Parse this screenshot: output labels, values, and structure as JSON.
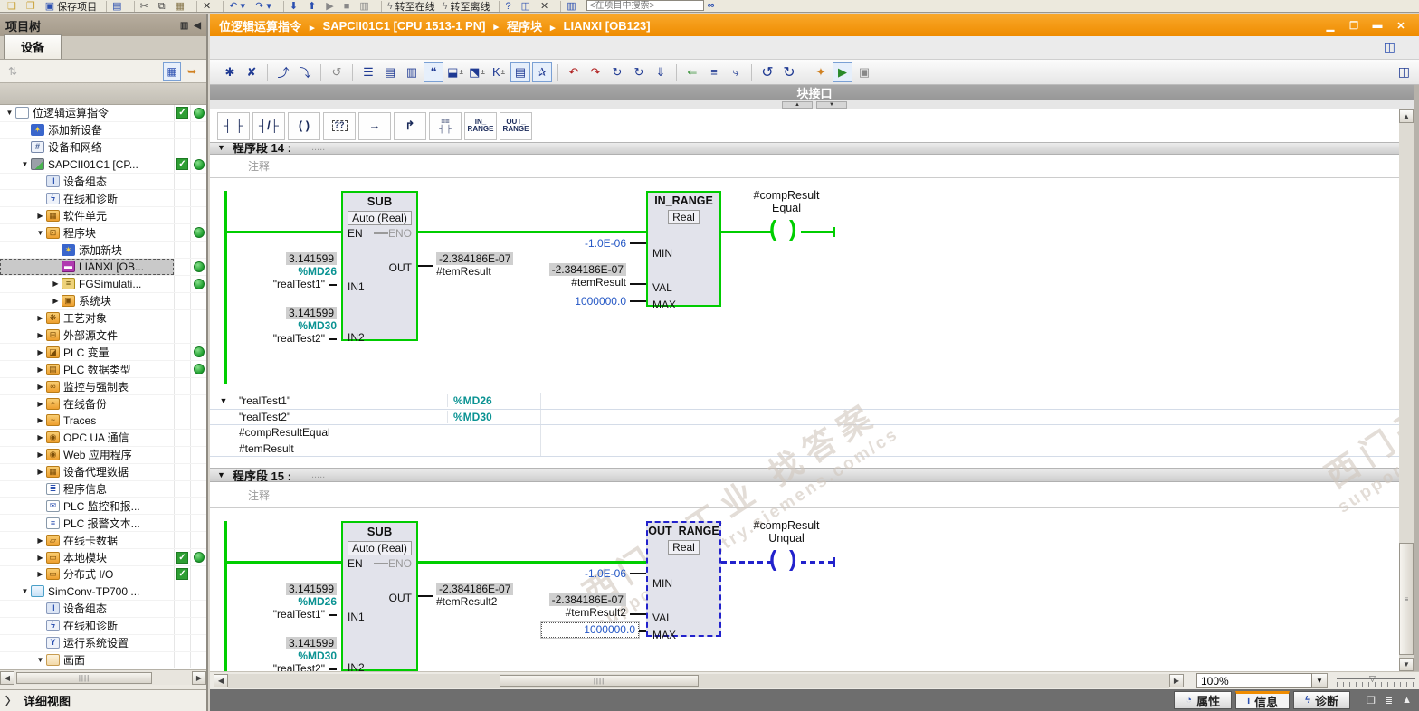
{
  "top_toolbar": {
    "search_placeholder": "<在项目中搜索>",
    "items": [
      {
        "n": "new-project",
        "g": "❏",
        "c": "#caa23a"
      },
      {
        "n": "open-project",
        "g": "❐",
        "c": "#caa23a"
      },
      {
        "n": "save-project-button",
        "g": "▣",
        "c": "#2b4fb0",
        "label": "保存项目"
      },
      {
        "n": "print-button",
        "g": "▤",
        "c": "#2b4fb0",
        "sep": 1
      },
      {
        "n": "cut-button",
        "g": "✂",
        "c": "#444",
        "sep": 1
      },
      {
        "n": "copy-button",
        "g": "⧉",
        "c": "#444"
      },
      {
        "n": "paste-button",
        "g": "▦",
        "c": "#8a7a50"
      },
      {
        "n": "delete-button",
        "g": "✕",
        "c": "#333",
        "sep": 1
      },
      {
        "n": "undo-button",
        "g": "↶ ▾",
        "c": "#2b4fb0",
        "sep": 1
      },
      {
        "n": "redo-button",
        "g": "↷ ▾",
        "c": "#2b4fb0"
      },
      {
        "n": "download-to-device-button",
        "g": "⬇",
        "c": "#2b4fb0",
        "sep": 1
      },
      {
        "n": "upload-from-device-button",
        "g": "⬆",
        "c": "#2b4fb0"
      },
      {
        "n": "start-cpu-button",
        "g": "▶",
        "c": "#888"
      },
      {
        "n": "stop-cpu-button",
        "g": "■",
        "c": "#888"
      },
      {
        "n": "start-runtime-button",
        "g": "▥",
        "c": "#888"
      },
      {
        "n": "go-online-button",
        "g": "ϟ",
        "c": "#777",
        "label": "转至在线",
        "sep": 1
      },
      {
        "n": "go-offline-button",
        "g": "ϟ",
        "c": "#777",
        "label": "转至离线"
      },
      {
        "n": "online-diagnostics-button",
        "g": "?",
        "c": "#2b4fb0",
        "sep": 1
      },
      {
        "n": "window-button",
        "g": "◫",
        "c": "#2b4fb0"
      },
      {
        "n": "cross-reference-button",
        "g": "✕",
        "c": "#444"
      },
      {
        "n": "split-editor-button",
        "g": "▥",
        "c": "#2b4fb0",
        "sep": 1
      }
    ],
    "find_icon": "∞"
  },
  "header": {
    "breadcrumb": [
      "位逻辑运算指令",
      "SAPCII01C1 [CPU 1513-1 PN]",
      "程序块",
      "LIANXI [OB123]"
    ],
    "window_buttons": [
      {
        "n": "minimize-button",
        "g": "▁"
      },
      {
        "n": "restore-button",
        "g": "❐"
      },
      {
        "n": "maximize-button",
        "g": "▬"
      },
      {
        "n": "close-button",
        "g": "✕"
      }
    ]
  },
  "project_tree": {
    "title": "项目树",
    "header_icons": [
      {
        "n": "pin-panel-button",
        "g": "▥"
      },
      {
        "n": "collapse-panel-button",
        "g": "◀"
      }
    ],
    "tab": "设备",
    "toolbar": [
      {
        "n": "sort-button",
        "g": "⇅",
        "gray": 1
      },
      {
        "n": "table-view-button",
        "g": "▦",
        "push": 1,
        "right": 1
      },
      {
        "n": "export-button",
        "g": "➥",
        "right": 1
      }
    ],
    "detail_view": "详细视图",
    "detail_chevron": "〉",
    "items": [
      {
        "l": "位逻辑运算指令",
        "lv": 0,
        "ex": "▼",
        "ic": "project",
        "chk": 1,
        "dot": 1
      },
      {
        "l": "添加新设备",
        "lv": 1,
        "ex": "",
        "ic": "add-device",
        "g": "✶"
      },
      {
        "l": "设备和网络",
        "lv": 1,
        "ex": "",
        "ic": "network",
        "g": "#"
      },
      {
        "l": "SAPCII01C1 [CP...",
        "lv": 1,
        "ex": "▼",
        "ic": "plc",
        "chk": 1,
        "dot": 1
      },
      {
        "l": "设备组态",
        "lv": 2,
        "ex": "",
        "ic": "devconf",
        "g": "‖"
      },
      {
        "l": "在线和诊断",
        "lv": 2,
        "ex": "",
        "ic": "diag",
        "g": "ϟ"
      },
      {
        "l": "软件单元",
        "lv": 2,
        "ex": "▶",
        "ic": "folder-units",
        "g": "▦"
      },
      {
        "l": "程序块",
        "lv": 2,
        "ex": "▼",
        "ic": "folder-blocks",
        "g": "⊡",
        "dot": 1
      },
      {
        "l": "添加新块",
        "lv": 3,
        "ex": "",
        "ic": "add-block",
        "g": "✶"
      },
      {
        "l": "LIANXI [OB...",
        "lv": 3,
        "ex": "",
        "ic": "ob",
        "g": "▬",
        "dot": 1,
        "sel": 1
      },
      {
        "l": "FGSimulati...",
        "lv": 3,
        "ex": "▶",
        "ic": "fb",
        "g": "≡",
        "dot": 1
      },
      {
        "l": "系统块",
        "lv": 3,
        "ex": "▶",
        "ic": "folder-sys",
        "g": "▣"
      },
      {
        "l": "工艺对象",
        "lv": 2,
        "ex": "▶",
        "ic": "folder-tech",
        "g": "❋"
      },
      {
        "l": "外部源文件",
        "lv": 2,
        "ex": "▶",
        "ic": "folder-src",
        "g": "⊟"
      },
      {
        "l": "PLC 变量",
        "lv": 2,
        "ex": "▶",
        "ic": "folder-tags",
        "g": "◪",
        "dot": 1
      },
      {
        "l": "PLC 数据类型",
        "lv": 2,
        "ex": "▶",
        "ic": "folder-types",
        "g": "▤",
        "dot": 1
      },
      {
        "l": "监控与强制表",
        "lv": 2,
        "ex": "▶",
        "ic": "folder-watch",
        "g": "∞"
      },
      {
        "l": "在线备份",
        "lv": 2,
        "ex": "▶",
        "ic": "folder-backup",
        "g": "◓"
      },
      {
        "l": "Traces",
        "lv": 2,
        "ex": "▶",
        "ic": "folder-traces",
        "g": "~"
      },
      {
        "l": "OPC UA 通信",
        "lv": 2,
        "ex": "▶",
        "ic": "folder-opc",
        "g": "◉"
      },
      {
        "l": "Web 应用程序",
        "lv": 2,
        "ex": "▶",
        "ic": "folder-web",
        "g": "◉"
      },
      {
        "l": "设备代理数据",
        "lv": 2,
        "ex": "▶",
        "ic": "folder-proxy",
        "g": "▦"
      },
      {
        "l": "程序信息",
        "lv": 2,
        "ex": "",
        "ic": "proginfo",
        "g": "≣"
      },
      {
        "l": "PLC 监控和报...",
        "lv": 2,
        "ex": "",
        "ic": "alarm",
        "g": "✉"
      },
      {
        "l": "PLC 报警文本...",
        "lv": 2,
        "ex": "",
        "ic": "alarmtext",
        "g": "≡"
      },
      {
        "l": "在线卡数据",
        "lv": 2,
        "ex": "▶",
        "ic": "folder-card",
        "g": "▱"
      },
      {
        "l": "本地模块",
        "lv": 2,
        "ex": "▶",
        "ic": "folder-local",
        "g": "▭",
        "chk": 1,
        "dot": 1
      },
      {
        "l": "分布式 I/O",
        "lv": 2,
        "ex": "▶",
        "ic": "folder-dio",
        "g": "▭",
        "chk": 1
      },
      {
        "l": "SimConv-TP700 ...",
        "lv": 1,
        "ex": "▼",
        "ic": "folder-hmi",
        "g": ""
      },
      {
        "l": "设备组态",
        "lv": 2,
        "ex": "",
        "ic": "devconf",
        "g": "‖"
      },
      {
        "l": "在线和诊断",
        "lv": 2,
        "ex": "",
        "ic": "diag",
        "g": "ϟ"
      },
      {
        "l": "运行系统设置",
        "lv": 2,
        "ex": "",
        "ic": "runtime",
        "g": "Y"
      },
      {
        "l": "画面",
        "lv": 2,
        "ex": "▼",
        "ic": "folder-screens",
        "g": ""
      }
    ]
  },
  "editor": {
    "block_interface_label": "块接口",
    "subbar_icon": "◫",
    "toolbar": [
      {
        "n": "insert-network-button",
        "g": "✱"
      },
      {
        "n": "delete-network-button",
        "g": "✘"
      },
      {
        "n": "open-branch-button",
        "g": "⤴",
        "sep": 1
      },
      {
        "n": "close-branch-button",
        "g": "⤵"
      },
      {
        "n": "reset-layout-button",
        "g": "↺",
        "c": "#888",
        "sep": 1
      },
      {
        "n": "expand-all-networks-button",
        "g": "☰",
        "sep": 1
      },
      {
        "n": "collapse-all-networks-button",
        "g": "▤"
      },
      {
        "n": "toggle-network-view-button",
        "g": "▥"
      },
      {
        "n": "network-comments-toggle",
        "g": "❝",
        "pressed": 1
      },
      {
        "n": "insert-block-dropdown",
        "g": "⬓",
        "dd": 1
      },
      {
        "n": "insert-placeholder-dropdown",
        "g": "⬔",
        "dd": 1
      },
      {
        "n": "rename-operand-dropdown",
        "g": "K",
        "dd": 1
      },
      {
        "n": "absolute-symbolic-toggle",
        "g": "▤",
        "pressed": 1
      },
      {
        "n": "favorites-toggle",
        "g": "✰",
        "pressed": 1
      },
      {
        "n": "previous-error-button",
        "g": "↶",
        "c": "#b02020",
        "sep": 1
      },
      {
        "n": "next-error-button",
        "g": "↷",
        "c": "#b02020"
      },
      {
        "n": "update-block-calls-button",
        "g": "↻"
      },
      {
        "n": "refresh-interface-button",
        "g": "↻"
      },
      {
        "n": "consistency-check-button",
        "g": "⇓"
      },
      {
        "n": "jump-to-start-button",
        "g": "⇐",
        "c": "#2a8a2a",
        "sep": 1
      },
      {
        "n": "insert-line-button",
        "g": "≡"
      },
      {
        "n": "branch-out-button",
        "g": "⤷"
      },
      {
        "n": "undo-button",
        "g": "↺",
        "big": 1,
        "sep": 1
      },
      {
        "n": "redo-button",
        "g": "↻",
        "big": 1
      },
      {
        "n": "go-to-usage-button",
        "g": "✦",
        "c": "#d08020",
        "sep": 1
      },
      {
        "n": "monitoring-toggle",
        "g": "▶",
        "c": "#2a8a2a",
        "pressed": 1
      },
      {
        "n": "snapshot-button",
        "g": "▣",
        "c": "#888"
      }
    ],
    "interface_arrows": [
      "▲",
      "▼"
    ],
    "favorites": [
      {
        "n": "contact-open-button",
        "l1": "┤ ├",
        "l2": ""
      },
      {
        "n": "contact-closed-button",
        "l1": "┤/├",
        "l2": ""
      },
      {
        "n": "coil-button",
        "l1": "( )",
        "l2": ""
      },
      {
        "n": "empty-box-button",
        "l1": "??",
        "l2": "",
        "boxed": 1
      },
      {
        "n": "open-branch-button",
        "l1": "→",
        "l2": ""
      },
      {
        "n": "close-branch-button",
        "l1": "↱",
        "l2": ""
      },
      {
        "n": "compare-contact-button",
        "l1": "==",
        "l2": "┤ ├",
        "small": 1
      },
      {
        "n": "in-range-button",
        "l1": "IN_",
        "l2": "RANGE",
        "small": 1
      },
      {
        "n": "out-range-button",
        "l1": "OUT_",
        "l2": "RANGE",
        "small": 1
      }
    ],
    "networks": [
      {
        "title": "程序段 14 :",
        "dots": ".....",
        "collapse": "▼",
        "comment": "注释",
        "sub": {
          "title": "SUB",
          "mode": "Auto (Real)",
          "en": "EN",
          "eno": "ENO",
          "pin_in1": "IN1",
          "pin_in2": "IN2",
          "pin_out": "OUT",
          "in1": {
            "value": "3.141599",
            "addr": "%MD26",
            "tag": "\"realTest1\""
          },
          "in2": {
            "value": "3.141599",
            "addr": "%MD30",
            "tag": "\"realTest2\""
          },
          "out": {
            "value": "-2.384186E-07",
            "tag": "#temResult"
          }
        },
        "range": {
          "title": "IN_RANGE",
          "dtype": "Real",
          "pin_min": "MIN",
          "pin_val": "VAL",
          "pin_max": "MAX",
          "min": "-1.0E-06",
          "val": {
            "value": "-2.384186E-07",
            "tag": "#temResult"
          },
          "max": "1000000.0"
        },
        "coil": {
          "line1": "#compResult",
          "line2": "Equal"
        }
      },
      {
        "title": "程序段 15 :",
        "dots": ".....",
        "collapse": "▼",
        "comment": "注释",
        "sub": {
          "title": "SUB",
          "mode": "Auto (Real)",
          "en": "EN",
          "eno": "ENO",
          "pin_in1": "IN1",
          "pin_in2": "IN2",
          "pin_out": "OUT",
          "in1": {
            "value": "3.141599",
            "addr": "%MD26",
            "tag": "\"realTest1\""
          },
          "in2": {
            "value": "3.141599",
            "addr": "%MD30",
            "tag": "\"realTest2\""
          },
          "out": {
            "value": "-2.384186E-07",
            "tag": "#temResult2"
          }
        },
        "range": {
          "title": "OUT_RANGE",
          "dtype": "Real",
          "pin_min": "MIN",
          "pin_val": "VAL",
          "pin_max": "MAX",
          "min": "-1.0E-06",
          "val": {
            "value": "-2.384186E-07",
            "tag": "#temResult2"
          },
          "max": "1000000.0"
        },
        "coil": {
          "line1": "#compResult",
          "line2": "Unqual"
        }
      }
    ],
    "var_table": [
      {
        "exp": "▼",
        "name": "\"realTest1\"",
        "addr": "%MD26"
      },
      {
        "exp": "",
        "name": "\"realTest2\"",
        "addr": "%MD30"
      },
      {
        "exp": "",
        "name": "#compResultEqual",
        "addr": ""
      },
      {
        "exp": "",
        "name": "#temResult",
        "addr": ""
      }
    ],
    "zoom_value": "100%"
  },
  "watermark": {
    "line1": "西门子工业  找答案",
    "line2": "support.industry.siemens.com/cs"
  },
  "status_bar": {
    "tabs": [
      {
        "n": "tab-properties",
        "label": "属性",
        "g": "◔"
      },
      {
        "n": "tab-info",
        "label": "信息",
        "g": "i",
        "active": 1
      },
      {
        "n": "tab-diagnostics",
        "label": "诊断",
        "g": "ϟ"
      }
    ],
    "right_icons": [
      {
        "n": "restore-pane-button",
        "g": "❐"
      },
      {
        "n": "pane-list-button",
        "g": "≣"
      },
      {
        "n": "expand-pane-button",
        "g": "▲"
      }
    ]
  },
  "colors": {
    "accent": "#ef8c00",
    "wire_green": "#00ce00",
    "select_blue": "#2222cc",
    "tag_teal": "#0b9393",
    "value_blue": "#2457c5"
  }
}
